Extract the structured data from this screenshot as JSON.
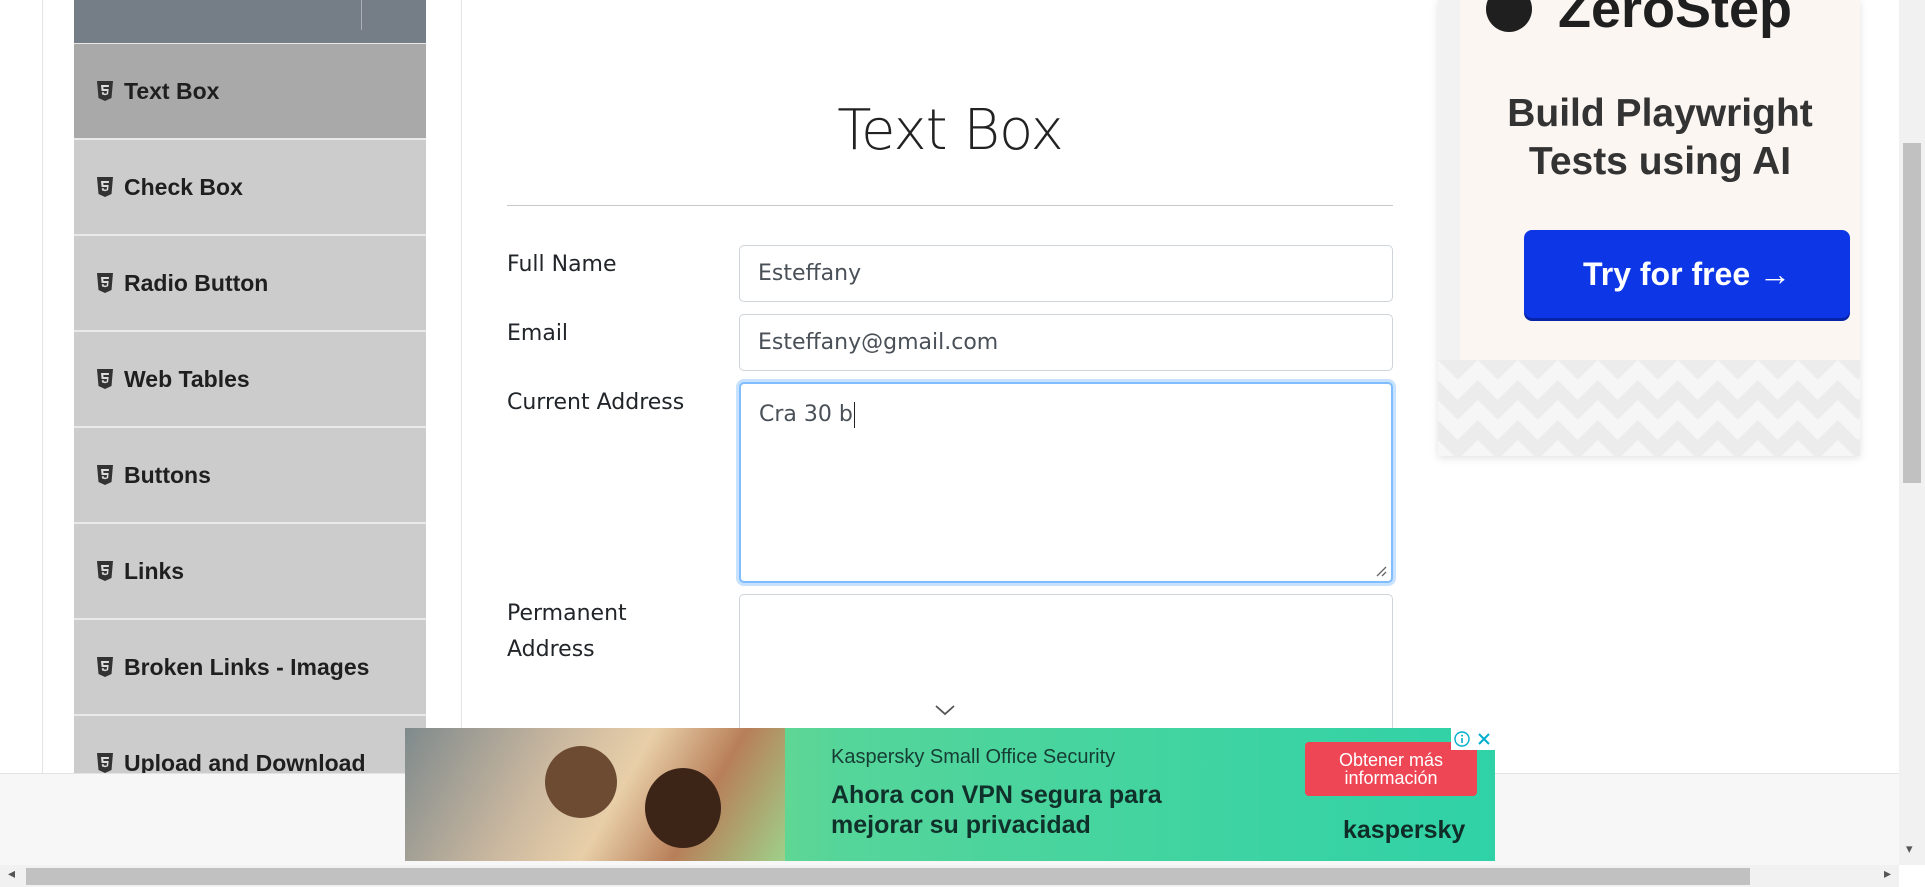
{
  "sidebar": {
    "items": [
      {
        "label": "Text Box",
        "active": true
      },
      {
        "label": "Check Box",
        "active": false
      },
      {
        "label": "Radio Button",
        "active": false
      },
      {
        "label": "Web Tables",
        "active": false
      },
      {
        "label": "Buttons",
        "active": false
      },
      {
        "label": "Links",
        "active": false
      },
      {
        "label": "Broken Links - Images",
        "active": false
      },
      {
        "label": "Upload and Download",
        "active": false
      }
    ],
    "item_icon": "html5-icon"
  },
  "main": {
    "title": "Text Box",
    "form": {
      "full_name": {
        "label": "Full Name",
        "value": "Esteffany"
      },
      "email": {
        "label": "Email",
        "value": "Esteffany@gmail.com"
      },
      "current_address": {
        "label": "Current Address",
        "value": "Cra 30 b"
      },
      "permanent_address": {
        "label_line1": "Permanent",
        "label_line2": "Address",
        "value": ""
      }
    }
  },
  "ad_right": {
    "brand": "ZeroStep",
    "headline_line1": "Build Playwright",
    "headline_line2": "Tests using AI",
    "cta": "Try for free →"
  },
  "ad_bottom": {
    "product": "Kaspersky Small Office Security",
    "headline_line1": "Ahora con VPN segura para",
    "headline_line2": "mejorar su privacidad",
    "cta_line1": "Obtener más",
    "cta_line2": "información",
    "brand": "kaspersky",
    "info_icon": "info-icon",
    "close_icon": "close-icon"
  },
  "colors": {
    "sidebar_item": "#cccccc",
    "sidebar_active": "#a9a9a9",
    "cta_blue": "#0d36e6",
    "kaspersky_cta": "#ef4655",
    "focus_border": "#80bdff"
  }
}
